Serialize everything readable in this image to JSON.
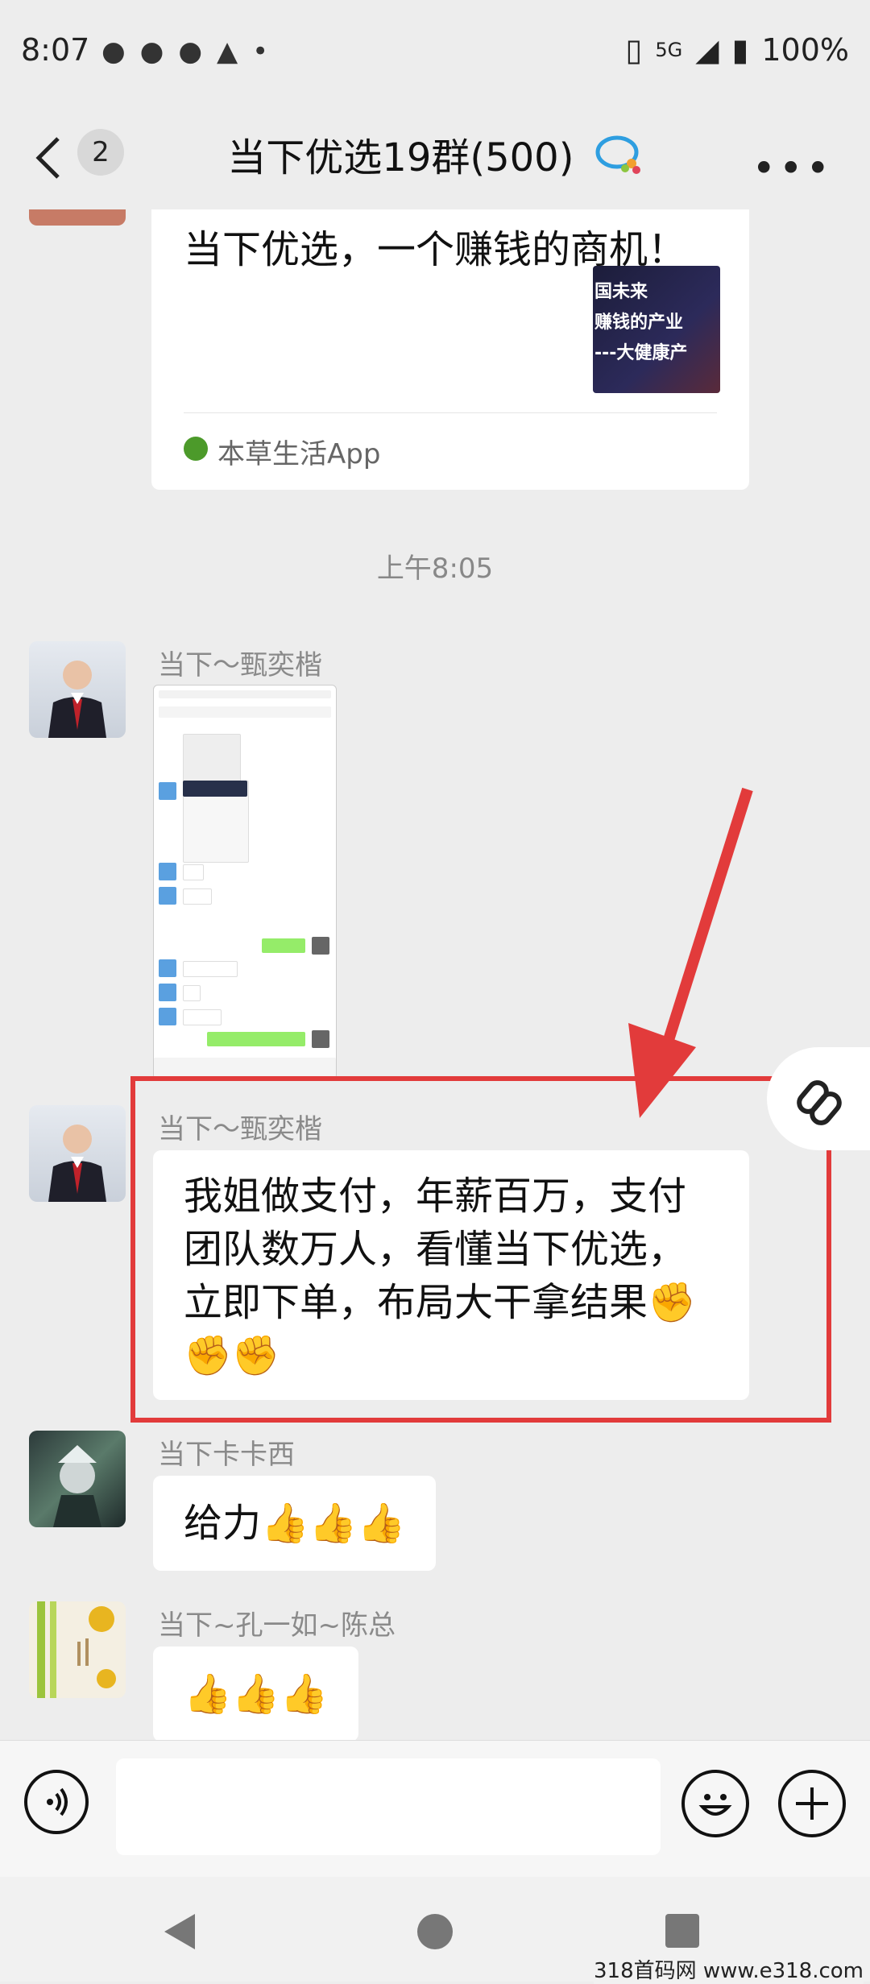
{
  "status": {
    "time": "8:07",
    "network": "5G",
    "battery": "100%"
  },
  "header": {
    "badge": "2",
    "title": "当下优选19群(500)"
  },
  "chat": {
    "card": {
      "title": "当下优选，一个赚钱的商机！",
      "thumb_lines": [
        "国未来",
        "赚钱的产业",
        "---大健康产"
      ],
      "source": "本草生活App"
    },
    "time_label": "上午8:05",
    "messages": [
      {
        "sender": "当下～甄奕楷",
        "type": "image"
      },
      {
        "sender": "当下～甄奕楷",
        "type": "text",
        "text": "我姐做支付，年薪百万，支付团队数万人，看懂当下优选，立即下单，布局大干拿结果✊✊✊"
      },
      {
        "sender": "当下卡卡西",
        "type": "text",
        "text": "给力👍👍👍"
      },
      {
        "sender": "当下~孔一如~陈总",
        "type": "text",
        "text": "👍👍👍"
      }
    ]
  },
  "watermark": "318首码网  www.e318.com",
  "colors": {
    "highlight": "#e23b3b",
    "background": "#ededed"
  }
}
